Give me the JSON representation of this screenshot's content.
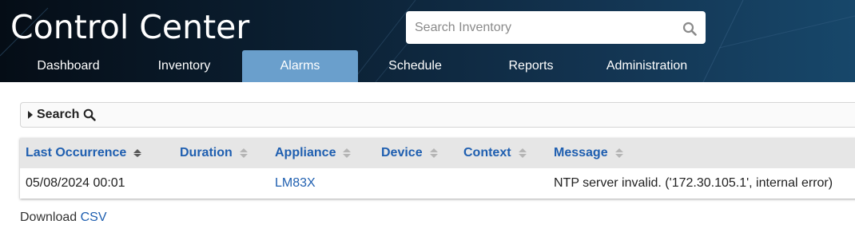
{
  "header": {
    "title": "Control Center",
    "search": {
      "placeholder": "Search Inventory",
      "icon": "search-icon"
    },
    "nav": [
      {
        "label": "Dashboard",
        "active": false
      },
      {
        "label": "Inventory",
        "active": false
      },
      {
        "label": "Alarms",
        "active": true
      },
      {
        "label": "Schedule",
        "active": false
      },
      {
        "label": "Reports",
        "active": false
      },
      {
        "label": "Administration",
        "active": false
      }
    ]
  },
  "search_panel": {
    "label": "Search",
    "icon": "search-icon"
  },
  "table": {
    "columns": [
      {
        "label": "Last Occurrence",
        "sorted": true
      },
      {
        "label": "Duration",
        "sorted": false
      },
      {
        "label": "Appliance",
        "sorted": false
      },
      {
        "label": "Device",
        "sorted": false
      },
      {
        "label": "Context",
        "sorted": false
      },
      {
        "label": "Message",
        "sorted": false
      }
    ],
    "rows": [
      {
        "last_occurrence": "05/08/2024 00:01",
        "duration": "",
        "appliance": "LM83X",
        "device": "",
        "context": "",
        "message": "NTP server invalid. ('172.30.105.1', internal error)"
      }
    ]
  },
  "download": {
    "prefix": "Download",
    "link": "CSV"
  },
  "colors": {
    "header_dark": "#050d16",
    "header_light": "#17476a",
    "active_tab": "#6a9fcc",
    "link": "#1f5fb0",
    "table_header_bg": "#e6e6e6"
  }
}
